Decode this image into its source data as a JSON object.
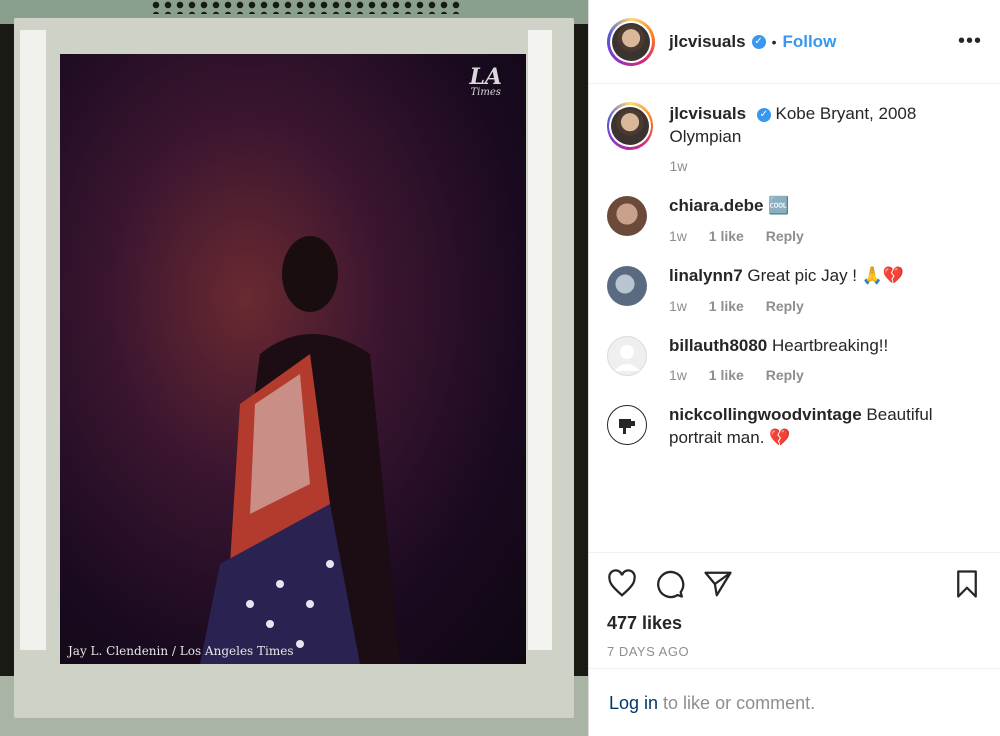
{
  "post": {
    "username": "jlcvisuals",
    "follow_label": "Follow",
    "separator": "•",
    "more_label": "•••",
    "verified_glyph": "✓"
  },
  "photo": {
    "logo_big": "LA",
    "logo_small": "Times",
    "credit": "Jay L. Clendenin / Los Angeles Times"
  },
  "caption": {
    "username": "jlcvisuals",
    "text": "Kobe Bryant, 2008 Olympian",
    "time": "1w"
  },
  "comments": [
    {
      "username": "chiara.debe",
      "text": " ",
      "emoji": "🆒",
      "time": "1w",
      "likes": "1 like",
      "reply": "Reply",
      "avatar_color": "#8a6a5a"
    },
    {
      "username": "linalynn7",
      "text": "Great pic Jay ! ",
      "emoji": "🙏💔",
      "time": "1w",
      "likes": "1 like",
      "reply": "Reply",
      "avatar_color": "#7a8aa0"
    },
    {
      "username": "billauth8080",
      "text": "Heartbreaking!!",
      "emoji": "",
      "time": "1w",
      "likes": "1 like",
      "reply": "Reply",
      "avatar_color": "#dbdbdb"
    },
    {
      "username": "nickcollingwoodvintage",
      "text": "Beautiful portrait man. ",
      "emoji": "💔",
      "avatar_color": "#ffffff"
    }
  ],
  "actions": {
    "likes": "477 likes",
    "ago": "7 DAYS AGO"
  },
  "login": {
    "link": "Log in",
    "rest": " to like or comment."
  },
  "colors": {
    "accent": "#3897f0",
    "muted": "#8e8e8e",
    "heart_red": "#ed4956"
  }
}
